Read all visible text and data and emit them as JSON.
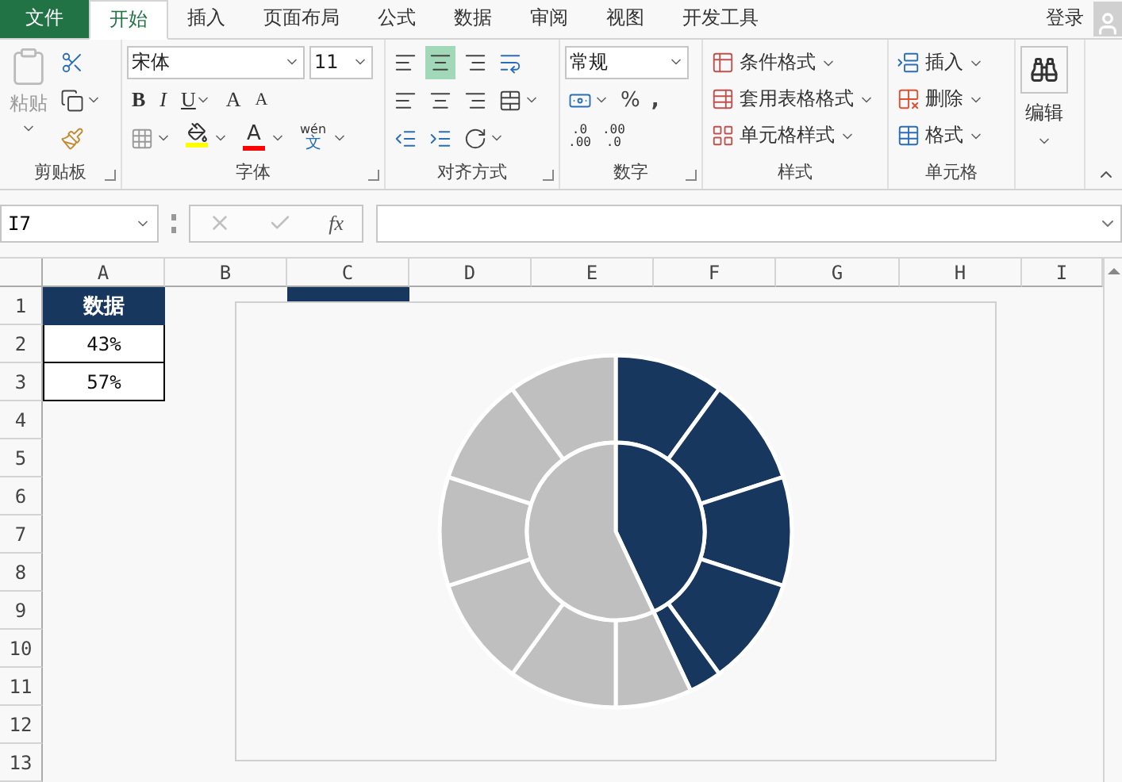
{
  "ribbon_tabs": [
    {
      "label": "文件",
      "kind": "file",
      "selected": false
    },
    {
      "label": "开始",
      "kind": "tab",
      "selected": true
    },
    {
      "label": "插入",
      "kind": "tab",
      "selected": false
    },
    {
      "label": "页面布局",
      "kind": "tab",
      "selected": false
    },
    {
      "label": "公式",
      "kind": "tab",
      "selected": false
    },
    {
      "label": "数据",
      "kind": "tab",
      "selected": false
    },
    {
      "label": "审阅",
      "kind": "tab",
      "selected": false
    },
    {
      "label": "视图",
      "kind": "tab",
      "selected": false
    },
    {
      "label": "开发工具",
      "kind": "tab",
      "selected": false
    }
  ],
  "account": {
    "label": "登录"
  },
  "clipboard": {
    "title": "剪贴板",
    "paste": "粘贴"
  },
  "font": {
    "title": "字体",
    "name": "宋体",
    "size": "11",
    "bold": "B",
    "italic": "I",
    "underline": "U",
    "grow": "A",
    "shrink": "A",
    "font_color": "A",
    "phonetic": [
      "wén",
      "文"
    ]
  },
  "alignment": {
    "title": "对齐方式",
    "vertical": [
      {
        "selected": false
      },
      {
        "selected": true
      },
      {
        "selected": false
      }
    ]
  },
  "number": {
    "title": "数字",
    "format": "常规",
    "percent": "%",
    "comma": ",",
    "increase_decimal": [
      ".0",
      ".00"
    ],
    "decrease_decimal": [
      ".00",
      ".0"
    ]
  },
  "styles": {
    "title": "样式",
    "items": [
      "条件格式",
      "套用表格格式",
      "单元格样式"
    ]
  },
  "cells": {
    "title": "单元格",
    "items": [
      "插入",
      "删除",
      "格式"
    ]
  },
  "editing": {
    "label": "编辑"
  },
  "formula_bar": {
    "name_box": "I7",
    "function_label": "fx"
  },
  "columns": [
    "A",
    "B",
    "C",
    "D",
    "E",
    "F",
    "G",
    "H",
    "I"
  ],
  "rows": [
    "1",
    "2",
    "3",
    "4",
    "5",
    "6",
    "7",
    "8",
    "9",
    "10",
    "11",
    "12",
    "13"
  ],
  "data_table": {
    "header": "数据",
    "values": [
      "43%",
      "57%"
    ]
  }
}
